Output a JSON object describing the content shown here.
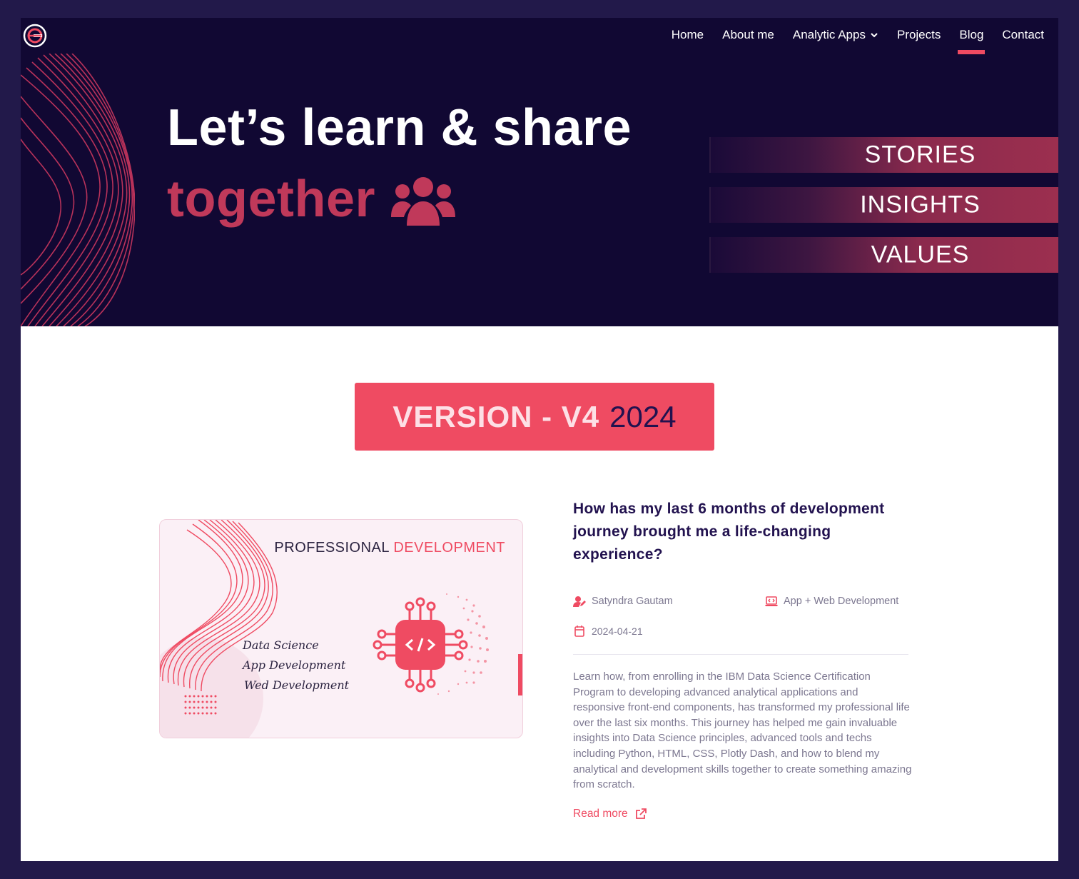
{
  "nav": {
    "items": [
      {
        "label": "Home"
      },
      {
        "label": "About me"
      },
      {
        "label": "Analytic Apps"
      },
      {
        "label": "Projects"
      },
      {
        "label": "Blog"
      },
      {
        "label": "Contact"
      }
    ]
  },
  "hero": {
    "headline_1": "Let’s learn & share",
    "headline_2": "together",
    "tags": [
      "STORIES",
      "INSIGHTS",
      "VALUES"
    ]
  },
  "version": {
    "label": "VERSION - V4",
    "year": "2024"
  },
  "post": {
    "image_title_1": "PROFESSIONAL",
    "image_title_2": "DEVELOPMENT",
    "image_skills": [
      "Data Science",
      "App Development",
      "Wed Development"
    ],
    "title": "How has my last 6 months of development journey brought me a life-changing experience?",
    "author": "Satyndra Gautam",
    "category": "App + Web Development",
    "date": "2024-04-21",
    "excerpt": "Learn how, from enrolling in the IBM Data Science Certification Program to developing advanced analytical applications and responsive front-end components, has transformed my professional life over the last six months. This journey has helped me gain invaluable insights into Data Science principles, advanced tools and techs including Python, HTML, CSS, Plotly Dash, and how to blend my analytical and development skills together to create something amazing from scratch.",
    "read_more": "Read more"
  },
  "colors": {
    "page_bg": "#22194a",
    "hero_bg": "#110833",
    "accent": "#ef4b62",
    "accent_dark": "#c0395a",
    "heading": "#22124f",
    "muted_text": "#7c7790"
  },
  "icons": [
    "logo-icon",
    "chevron-down-icon",
    "users-group-icon",
    "author-icon",
    "laptop-code-icon",
    "calendar-icon",
    "external-link-icon"
  ]
}
